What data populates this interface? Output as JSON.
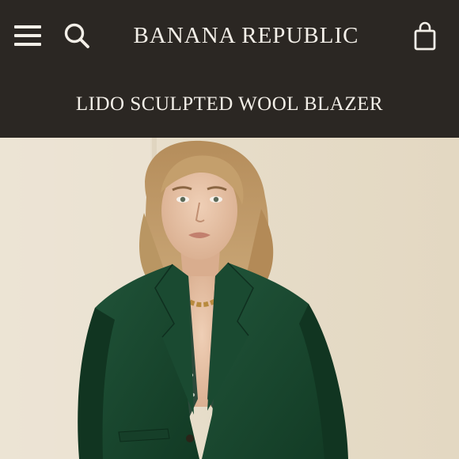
{
  "header": {
    "brand": "BANANA REPUBLIC",
    "icons": {
      "menu": "hamburger-menu-icon",
      "search": "search-icon",
      "bag": "shopping-bag-icon"
    }
  },
  "product": {
    "title": "LIDO SCULPTED WOOL BLAZER"
  },
  "colors": {
    "header_bg": "#2b2723",
    "header_text": "#f3efe8",
    "photo_backdrop": "#e9dfcc",
    "blazer_green": "#1d4a30"
  }
}
